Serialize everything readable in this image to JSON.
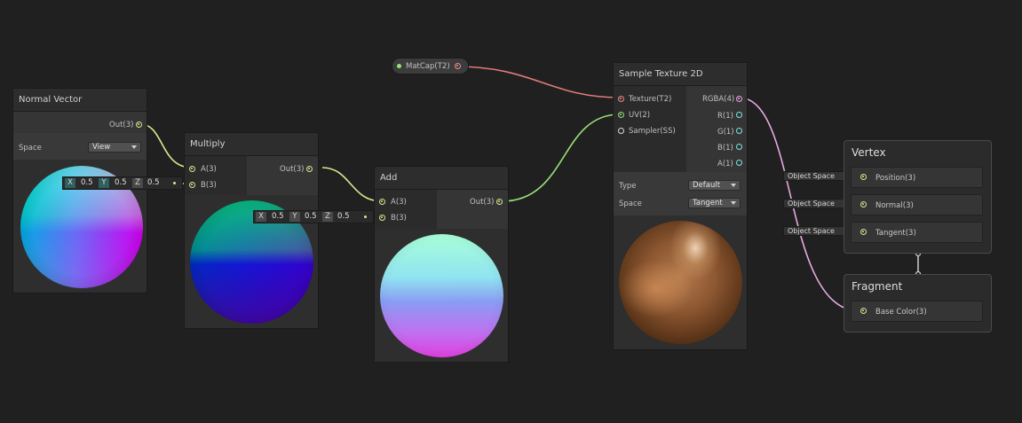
{
  "property_node": {
    "label": "MatCap(T2)"
  },
  "normal_vector": {
    "title": "Normal Vector",
    "out": "Out(3)",
    "space_label": "Space",
    "space_value": "View"
  },
  "multiply": {
    "title": "Multiply",
    "in_a": "A(3)",
    "in_b": "B(3)",
    "out": "Out(3)",
    "b_default": {
      "x_label": "X",
      "x": "0.5",
      "y_label": "Y",
      "y": "0.5",
      "z_label": "Z",
      "z": "0.5"
    }
  },
  "add": {
    "title": "Add",
    "in_a": "A(3)",
    "in_b": "B(3)",
    "out": "Out(3)",
    "b_default": {
      "x_label": "X",
      "x": "0.5",
      "y_label": "Y",
      "y": "0.5",
      "z_label": "Z",
      "z": "0.5"
    }
  },
  "sample_texture": {
    "title": "Sample Texture 2D",
    "inputs": [
      "Texture(T2)",
      "UV(2)",
      "Sampler(SS)"
    ],
    "outputs": [
      "RGBA(4)",
      "R(1)",
      "G(1)",
      "B(1)",
      "A(1)"
    ],
    "type_label": "Type",
    "type_value": "Default",
    "space_label": "Space",
    "space_value": "Tangent"
  },
  "vertex": {
    "title": "Vertex",
    "blocks": [
      "Position(3)",
      "Normal(3)",
      "Tangent(3)"
    ],
    "slot_labels": [
      "Object Space",
      "Object Space",
      "Object Space"
    ]
  },
  "fragment": {
    "title": "Fragment",
    "blocks": [
      "Base Color(3)"
    ]
  },
  "colors": {
    "vector3": "#d9e88c",
    "vector2": "#98e07a",
    "texture": "#ef8a8a",
    "vector4": "#f0a0e8",
    "float": "#7fe6ea",
    "background": "#202020"
  }
}
